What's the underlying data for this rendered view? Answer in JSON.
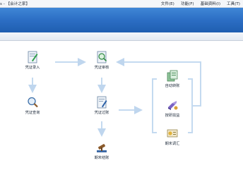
{
  "titlebar": {
    "app_title": "s - 【会计之家】"
  },
  "menu": {
    "file": "文件(E)",
    "function": "功能(F)",
    "basic_data": "基础资料(I)",
    "tools": "工具(T)"
  },
  "flow": {
    "voucher_entry": "凭证录入",
    "voucher_review": "凭证审核",
    "voucher_query": "凭证查询",
    "voucher_posting": "凭证过账",
    "period_close": "期末结账",
    "auto_transfer": "自动转账",
    "fx_profit_loss": "按研损益",
    "period_adjust": "期末调汇"
  }
}
